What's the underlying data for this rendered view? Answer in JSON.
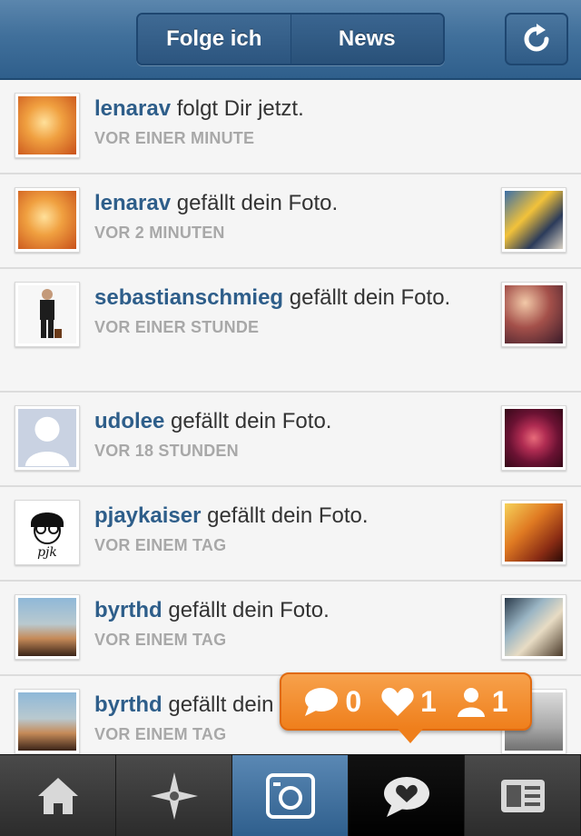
{
  "header": {
    "segments": [
      "Folge ich",
      "News"
    ],
    "active_segment": "News"
  },
  "notifications": [
    {
      "user": "lenarav",
      "action": " folgt Dir jetzt.",
      "time": "VOR EINER MINUTE",
      "has_thumb": false
    },
    {
      "user": "lenarav",
      "action": " gefällt dein Foto.",
      "time": "VOR 2 MINUTEN",
      "has_thumb": true
    },
    {
      "user": "sebastianschmieg",
      "action": " gefällt dein Foto.",
      "time": "VOR EINER STUNDE",
      "has_thumb": true
    },
    {
      "user": "udolee",
      "action": " gefällt dein Foto.",
      "time": "VOR 18 STUNDEN",
      "has_thumb": true
    },
    {
      "user": "pjaykaiser",
      "action": " gefällt dein Foto.",
      "time": "VOR EINEM TAG",
      "has_thumb": true
    },
    {
      "user": "byrthd",
      "action": " gefällt dein Foto.",
      "time": "VOR EINEM TAG",
      "has_thumb": true
    },
    {
      "user": "byrthd",
      "action": " gefällt dein Foto.",
      "time": "VOR EINEM TAG",
      "has_thumb": true
    }
  ],
  "popup": {
    "comments": "0",
    "likes": "1",
    "followers": "1"
  },
  "tabs": [
    {
      "icon": "home-icon"
    },
    {
      "icon": "explore-icon"
    },
    {
      "icon": "camera-icon"
    },
    {
      "icon": "news-icon"
    },
    {
      "icon": "profile-icon"
    }
  ],
  "colors": {
    "header": "#41709b",
    "username": "#2e5e8a",
    "popup": "#ef7f1c"
  }
}
